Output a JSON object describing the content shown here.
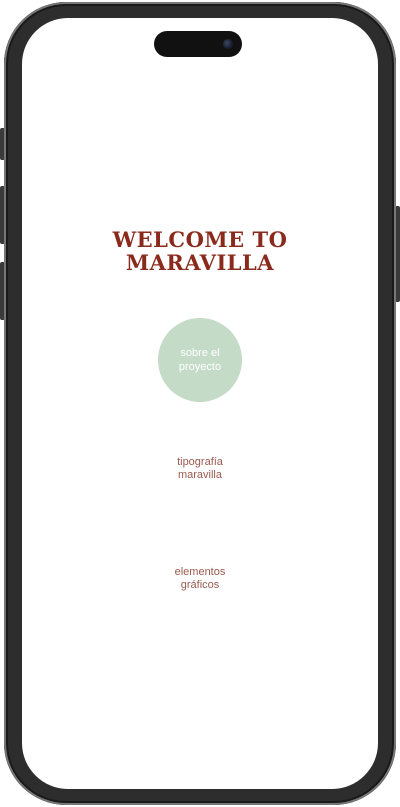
{
  "header": {
    "title": "WELCOME TO\nMARAVILLA"
  },
  "nav": {
    "about": "sobre el\nproyecto",
    "typography": "tipografía\nmaravilla",
    "graphic_elements": "elementos\ngráficos"
  },
  "colors": {
    "title": "#8a2a1c",
    "circle": "#c3dbc7",
    "link": "#9a5a4e"
  }
}
